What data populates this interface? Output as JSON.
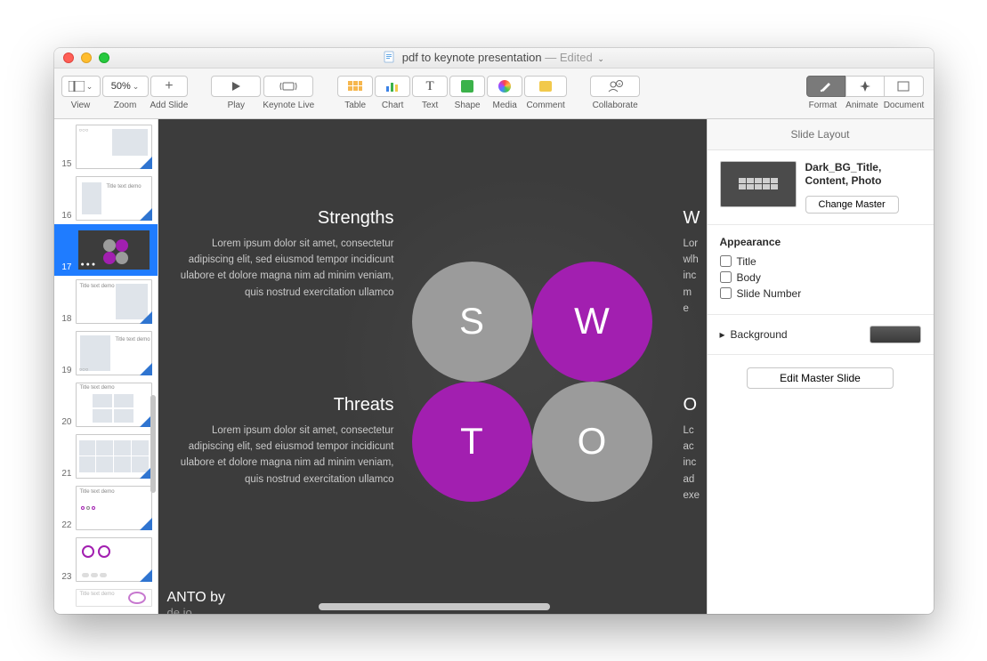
{
  "window": {
    "title": "pdf to keynote presentation",
    "status": "— Edited"
  },
  "toolbar": {
    "view": "View",
    "zoom_value": "50%",
    "zoom": "Zoom",
    "add_slide": "Add Slide",
    "play": "Play",
    "keynote_live": "Keynote Live",
    "table": "Table",
    "chart": "Chart",
    "text": "Text",
    "shape": "Shape",
    "media": "Media",
    "comment": "Comment",
    "collaborate": "Collaborate",
    "format": "Format",
    "animate": "Animate",
    "document": "Document"
  },
  "nav": {
    "slides": [
      {
        "n": "15"
      },
      {
        "n": "16"
      },
      {
        "n": "17",
        "selected": true
      },
      {
        "n": "18"
      },
      {
        "n": "19"
      },
      {
        "n": "20"
      },
      {
        "n": "21"
      },
      {
        "n": "22"
      },
      {
        "n": "23"
      }
    ]
  },
  "slide": {
    "strengths_h": "Strengths",
    "threats_h": "Threats",
    "weak_h": "W",
    "opp_h": "O",
    "lorem": "Lorem ipsum dolor sit amet, consectetur adipiscing elit, sed eiusmod tempor incidicunt ulabore et dolore magna nim ad minim veniam, quis nostrud exercitation ullamco",
    "weak_trunc": "Lor\nwlh\ninc\nm\ne",
    "opp_trunc": "Lc\nac\ninc\nad\nexe",
    "swot": {
      "s": "S",
      "w": "W",
      "t": "T",
      "o": "O"
    },
    "brand": "ANTO by",
    "brand_sub": "de.io"
  },
  "inspector": {
    "header": "Slide Layout",
    "master_name": "Dark_BG_Title, Content, Photo",
    "change_master": "Change Master",
    "appearance": "Appearance",
    "title_chk": "Title",
    "body_chk": "Body",
    "slidenum_chk": "Slide Number",
    "background": "Background",
    "edit_master": "Edit Master Slide"
  }
}
